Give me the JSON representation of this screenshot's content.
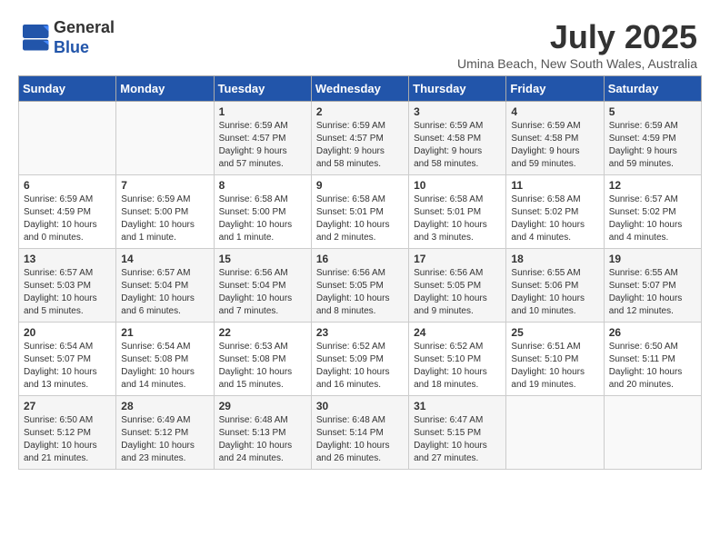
{
  "header": {
    "logo_line1": "General",
    "logo_line2": "Blue",
    "month": "July 2025",
    "location": "Umina Beach, New South Wales, Australia"
  },
  "weekdays": [
    "Sunday",
    "Monday",
    "Tuesday",
    "Wednesday",
    "Thursday",
    "Friday",
    "Saturday"
  ],
  "weeks": [
    [
      {
        "day": "",
        "info": ""
      },
      {
        "day": "",
        "info": ""
      },
      {
        "day": "1",
        "info": "Sunrise: 6:59 AM\nSunset: 4:57 PM\nDaylight: 9 hours\nand 57 minutes."
      },
      {
        "day": "2",
        "info": "Sunrise: 6:59 AM\nSunset: 4:57 PM\nDaylight: 9 hours\nand 58 minutes."
      },
      {
        "day": "3",
        "info": "Sunrise: 6:59 AM\nSunset: 4:58 PM\nDaylight: 9 hours\nand 58 minutes."
      },
      {
        "day": "4",
        "info": "Sunrise: 6:59 AM\nSunset: 4:58 PM\nDaylight: 9 hours\nand 59 minutes."
      },
      {
        "day": "5",
        "info": "Sunrise: 6:59 AM\nSunset: 4:59 PM\nDaylight: 9 hours\nand 59 minutes."
      }
    ],
    [
      {
        "day": "6",
        "info": "Sunrise: 6:59 AM\nSunset: 4:59 PM\nDaylight: 10 hours\nand 0 minutes."
      },
      {
        "day": "7",
        "info": "Sunrise: 6:59 AM\nSunset: 5:00 PM\nDaylight: 10 hours\nand 1 minute."
      },
      {
        "day": "8",
        "info": "Sunrise: 6:58 AM\nSunset: 5:00 PM\nDaylight: 10 hours\nand 1 minute."
      },
      {
        "day": "9",
        "info": "Sunrise: 6:58 AM\nSunset: 5:01 PM\nDaylight: 10 hours\nand 2 minutes."
      },
      {
        "day": "10",
        "info": "Sunrise: 6:58 AM\nSunset: 5:01 PM\nDaylight: 10 hours\nand 3 minutes."
      },
      {
        "day": "11",
        "info": "Sunrise: 6:58 AM\nSunset: 5:02 PM\nDaylight: 10 hours\nand 4 minutes."
      },
      {
        "day": "12",
        "info": "Sunrise: 6:57 AM\nSunset: 5:02 PM\nDaylight: 10 hours\nand 4 minutes."
      }
    ],
    [
      {
        "day": "13",
        "info": "Sunrise: 6:57 AM\nSunset: 5:03 PM\nDaylight: 10 hours\nand 5 minutes."
      },
      {
        "day": "14",
        "info": "Sunrise: 6:57 AM\nSunset: 5:04 PM\nDaylight: 10 hours\nand 6 minutes."
      },
      {
        "day": "15",
        "info": "Sunrise: 6:56 AM\nSunset: 5:04 PM\nDaylight: 10 hours\nand 7 minutes."
      },
      {
        "day": "16",
        "info": "Sunrise: 6:56 AM\nSunset: 5:05 PM\nDaylight: 10 hours\nand 8 minutes."
      },
      {
        "day": "17",
        "info": "Sunrise: 6:56 AM\nSunset: 5:05 PM\nDaylight: 10 hours\nand 9 minutes."
      },
      {
        "day": "18",
        "info": "Sunrise: 6:55 AM\nSunset: 5:06 PM\nDaylight: 10 hours\nand 10 minutes."
      },
      {
        "day": "19",
        "info": "Sunrise: 6:55 AM\nSunset: 5:07 PM\nDaylight: 10 hours\nand 12 minutes."
      }
    ],
    [
      {
        "day": "20",
        "info": "Sunrise: 6:54 AM\nSunset: 5:07 PM\nDaylight: 10 hours\nand 13 minutes."
      },
      {
        "day": "21",
        "info": "Sunrise: 6:54 AM\nSunset: 5:08 PM\nDaylight: 10 hours\nand 14 minutes."
      },
      {
        "day": "22",
        "info": "Sunrise: 6:53 AM\nSunset: 5:08 PM\nDaylight: 10 hours\nand 15 minutes."
      },
      {
        "day": "23",
        "info": "Sunrise: 6:52 AM\nSunset: 5:09 PM\nDaylight: 10 hours\nand 16 minutes."
      },
      {
        "day": "24",
        "info": "Sunrise: 6:52 AM\nSunset: 5:10 PM\nDaylight: 10 hours\nand 18 minutes."
      },
      {
        "day": "25",
        "info": "Sunrise: 6:51 AM\nSunset: 5:10 PM\nDaylight: 10 hours\nand 19 minutes."
      },
      {
        "day": "26",
        "info": "Sunrise: 6:50 AM\nSunset: 5:11 PM\nDaylight: 10 hours\nand 20 minutes."
      }
    ],
    [
      {
        "day": "27",
        "info": "Sunrise: 6:50 AM\nSunset: 5:12 PM\nDaylight: 10 hours\nand 21 minutes."
      },
      {
        "day": "28",
        "info": "Sunrise: 6:49 AM\nSunset: 5:12 PM\nDaylight: 10 hours\nand 23 minutes."
      },
      {
        "day": "29",
        "info": "Sunrise: 6:48 AM\nSunset: 5:13 PM\nDaylight: 10 hours\nand 24 minutes."
      },
      {
        "day": "30",
        "info": "Sunrise: 6:48 AM\nSunset: 5:14 PM\nDaylight: 10 hours\nand 26 minutes."
      },
      {
        "day": "31",
        "info": "Sunrise: 6:47 AM\nSunset: 5:15 PM\nDaylight: 10 hours\nand 27 minutes."
      },
      {
        "day": "",
        "info": ""
      },
      {
        "day": "",
        "info": ""
      }
    ]
  ]
}
